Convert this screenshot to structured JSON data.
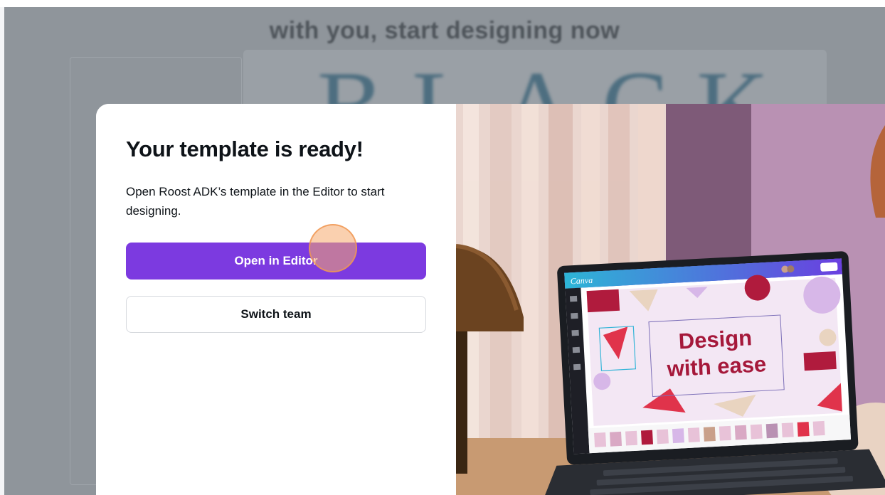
{
  "background": {
    "headline": "with you, start designing now",
    "big_text": "BLACK"
  },
  "modal": {
    "title": "Your template is ready!",
    "description": "Open Roost ADK’s template in the Editor to start designing.",
    "primary_button": "Open in Editor",
    "secondary_button": "Switch team"
  },
  "illustration": {
    "app_logo": "Canva",
    "design_line1": "Design",
    "design_line2": "with ease"
  },
  "colors": {
    "primary": "#7c3ae0",
    "text": "#0e1318",
    "accent_red": "#e0334b",
    "accent_maroon": "#a5183a"
  }
}
